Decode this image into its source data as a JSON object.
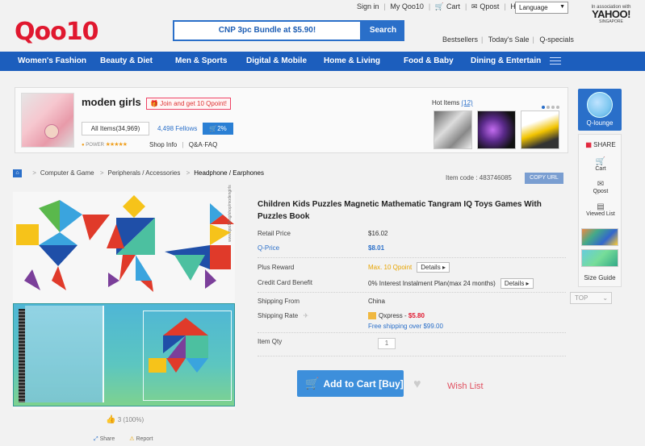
{
  "util": {
    "sign_in": "Sign in",
    "my_qoo10": "My Qoo10",
    "cart": "Cart",
    "qpost": "Qpost",
    "help": "Help",
    "language": "Language",
    "assoc": "In association with",
    "yahoo": "YAHOO!",
    "yahoo_region": "SINGAPORE"
  },
  "header": {
    "logo": "Qoo10",
    "search_text": "CNP 3pc Bundle at $5.90!",
    "search_button": "Search",
    "bestsellers": "Bestsellers",
    "todays_sale": "Today's Sale",
    "q_specials": "Q-specials"
  },
  "nav": [
    "Women's Fashion",
    "Beauty & Diet",
    "Men & Sports",
    "Digital & Mobile",
    "Home & Living",
    "Food & Baby",
    "Dining & Entertain"
  ],
  "shop": {
    "name": "moden girls",
    "join": "Join and get 10 Qpoint!",
    "all_items": "All Items(34,969)",
    "fellows": "4,498 Fellows",
    "percent": "2%",
    "power": "POWER",
    "stars": "★★★★★",
    "shop_info": "Shop Info",
    "qa": "Q&A·FAQ",
    "hot_items_label": "Hot Items",
    "hot_items_count": "(12)"
  },
  "sidebar": {
    "q_lounge": "Q-lounge",
    "share": "SHARE",
    "cart": "Cart",
    "qpost": "Qpost",
    "viewed_list": "Viewed List",
    "size_guide": "Size Guide",
    "top": "TOP"
  },
  "breadcrumb": [
    "Computer & Game",
    "Peripherals / Accessories",
    "Headphone / Earphones"
  ],
  "item_code": "Item code : 483746085",
  "copy_url": "COPY URL",
  "product": {
    "title": "Children Kids Puzzles Magnetic Mathematic Tangram IQ Toys Games With Puzzles Book",
    "retail_label": "Retail Price",
    "retail_value": "$16.02",
    "qprice_label": "Q-Price",
    "qprice_value": "$8.01",
    "reward_label": "Plus Reward",
    "reward_value": "Max. 10 Qpoint",
    "details": "Details",
    "cc_label": "Credit Card Benefit",
    "cc_value": "0% Interest Instalment Plan(max 24 months)",
    "ship_from_label": "Shipping From",
    "ship_from_value": "China",
    "ship_rate_label": "Shipping Rate",
    "ship_method": "Qxpress -",
    "ship_fee": "$5.80",
    "free_ship": "Free shipping over $99.00",
    "qty_label": "Item Qty",
    "qty_value": "1",
    "add_to_cart": "Add to Cart [Buy]",
    "wish_list": "Wish List",
    "likes": "3 (100%)",
    "share": "Share",
    "report": "Report",
    "watermark": "www.qoo10.sg/shop/modengirls"
  },
  "colors": {
    "brand_red": "#e0182f",
    "nav_blue": "#1c5ebd",
    "accent_blue": "#2a6fc9",
    "cart_blue": "#3d8fdb"
  }
}
